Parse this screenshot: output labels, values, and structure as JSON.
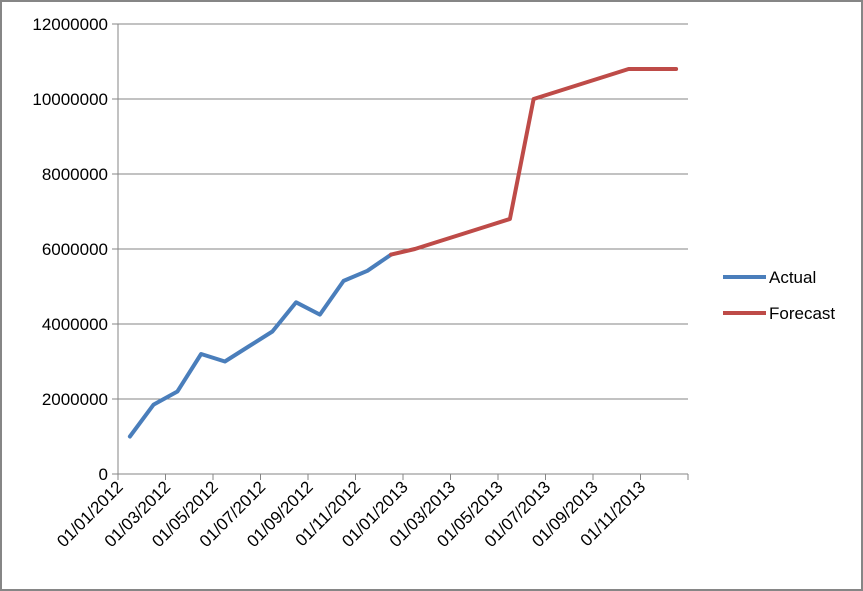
{
  "chart_data": {
    "type": "line",
    "title": "",
    "xlabel": "",
    "ylabel": "",
    "ylim": [
      0,
      12000000
    ],
    "y_ticks": [
      0,
      2000000,
      4000000,
      6000000,
      8000000,
      10000000,
      12000000
    ],
    "y_tick_labels": [
      "0",
      "2000000",
      "4000000",
      "6000000",
      "8000000",
      "10000000",
      "12000000"
    ],
    "x_tick_labels": [
      "01/01/2012",
      "01/03/2012",
      "01/05/2012",
      "01/07/2012",
      "01/09/2012",
      "01/11/2012",
      "01/01/2013",
      "01/03/2013",
      "01/05/2013",
      "01/07/2013",
      "01/09/2013",
      "01/11/2013"
    ],
    "x": [
      "2012-01",
      "2012-02",
      "2012-03",
      "2012-04",
      "2012-05",
      "2012-06",
      "2012-07",
      "2012-08",
      "2012-09",
      "2012-10",
      "2012-11",
      "2012-12",
      "2013-01",
      "2013-02",
      "2013-03",
      "2013-04",
      "2013-05",
      "2013-06",
      "2013-07",
      "2013-08",
      "2013-09",
      "2013-10",
      "2013-11",
      "2013-12"
    ],
    "grid": true,
    "legend": "right",
    "series": [
      {
        "name": "Actual",
        "color": "#4A7EBB",
        "values": [
          1000000,
          1850000,
          2200000,
          3200000,
          3000000,
          3400000,
          3800000,
          4580000,
          4250000,
          5150000,
          5420000,
          5850000,
          null,
          null,
          null,
          null,
          null,
          null,
          null,
          null,
          null,
          null,
          null,
          null
        ]
      },
      {
        "name": "Forecast",
        "color": "#BE4B48",
        "values": [
          null,
          null,
          null,
          null,
          null,
          null,
          null,
          null,
          null,
          null,
          null,
          5850000,
          6000000,
          6200000,
          6400000,
          6600000,
          6800000,
          10000000,
          10200000,
          10400000,
          10600000,
          10800000,
          10800000,
          10800000
        ]
      }
    ]
  }
}
